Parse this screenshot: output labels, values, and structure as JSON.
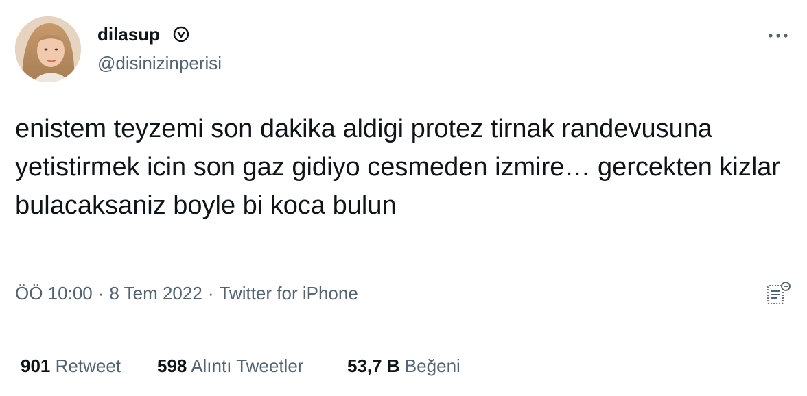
{
  "user": {
    "display_name": "dilasup",
    "handle": "@disinizinperisi",
    "verified_icon": "verified-badge"
  },
  "tweet": {
    "text": "enistem teyzemi son dakika aldigi protez tirnak randevusuna yetistirmek icin son gaz gidiyo cesmeden izmire… gercekten kizlar bulacaksaniz boyle bi koca bulun",
    "time": "ÖÖ 10:00",
    "date": "8 Tem 2022",
    "source": "Twitter for iPhone",
    "separator": "·"
  },
  "stats": {
    "retweets": {
      "count": "901",
      "label": "Retweet"
    },
    "quotes": {
      "count": "598",
      "label": "Alıntı Tweetler"
    },
    "likes": {
      "count": "53,7 B",
      "label": "Beğeni"
    }
  },
  "icons": {
    "more": "more-horizontal-icon",
    "analytics": "analytics-icon"
  },
  "colors": {
    "text_primary": "#0f1419",
    "text_secondary": "#536471",
    "divider": "#eff3f4"
  }
}
